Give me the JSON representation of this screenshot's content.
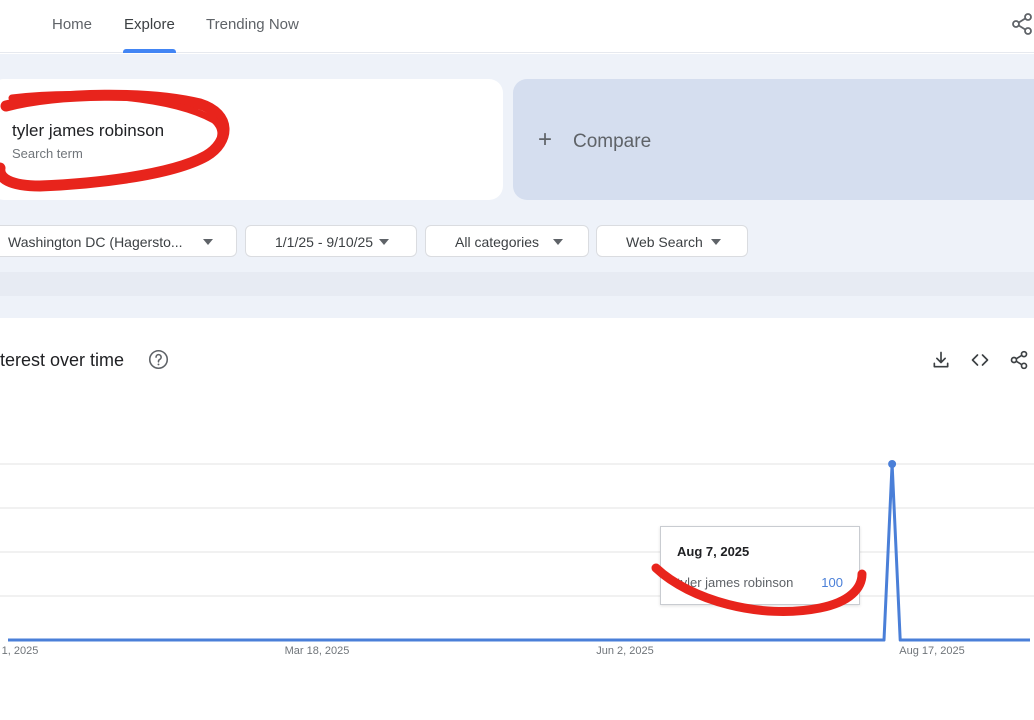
{
  "nav": {
    "tabs": [
      {
        "label": "Home"
      },
      {
        "label": "Explore"
      },
      {
        "label": "Trending Now"
      }
    ]
  },
  "search": {
    "term": "tyler james robinson",
    "term_sublabel": "Search term",
    "compare_label": "Compare"
  },
  "filters": {
    "region": "Washington DC (Hagersto...",
    "date_range": "1/1/25 - 9/10/25",
    "category": "All categories",
    "search_type": "Web Search"
  },
  "panel": {
    "title": "terest over time"
  },
  "chart_data": {
    "type": "line",
    "title": "terest over time",
    "x_ticks": [
      "1, 2025",
      "Mar 18, 2025",
      "Jun 2, 2025",
      "Aug 17, 2025"
    ],
    "series": [
      {
        "name": "tyler james robinson",
        "points": [
          {
            "date": "2025-01-01",
            "value": 0
          },
          {
            "date": "2025-08-05",
            "value": 0
          },
          {
            "date": "2025-08-07",
            "value": 100
          },
          {
            "date": "2025-08-09",
            "value": 0
          },
          {
            "date": "2025-09-10",
            "value": 0
          }
        ]
      }
    ],
    "ylim": [
      0,
      100
    ],
    "grid": true,
    "color": "#4a7fd8"
  },
  "tooltip": {
    "date": "Aug 7, 2025",
    "term": "tyler james robinson",
    "value": "100"
  },
  "colors": {
    "accent": "#4285f4",
    "line": "#4a7fd8",
    "annotation": "#e8241c"
  }
}
